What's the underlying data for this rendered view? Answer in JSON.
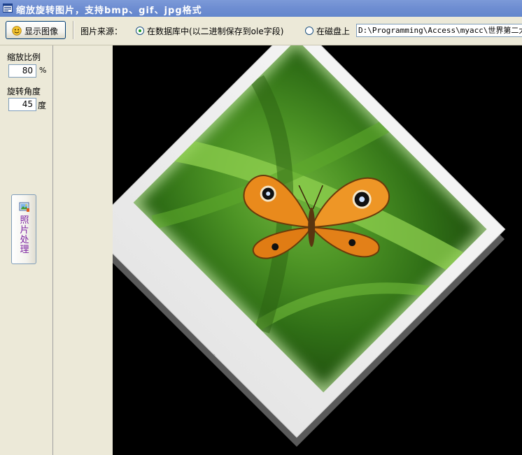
{
  "window": {
    "title": "缩放旋转图片，支持bmp、gif、jpg格式",
    "icon": "form-window-icon"
  },
  "toolbar": {
    "show_button_label": "显示图像",
    "show_button_icon": "smiley-image-icon",
    "source_label": "图片来源：",
    "radio_db_label": "在数据库中(以二进制保存到ole字段)",
    "radio_db_selected": true,
    "radio_disk_label": "在磁盘上",
    "radio_disk_selected": false,
    "path_value": "D:\\Programming\\Access\\myacc\\世界第二大衬"
  },
  "left_panel": {
    "scale_label": "缩放比例",
    "scale_value": "80",
    "scale_unit": "%",
    "rotate_label": "旋转角度",
    "rotate_value": "45",
    "rotate_unit": "度",
    "photo_button_label": "照片处理",
    "photo_button_icon": "photo-edit-icon"
  },
  "canvas": {
    "background": "#000000",
    "image_subject": "butterfly-on-grass",
    "rotation_degrees": 45,
    "scale_percent": 80
  }
}
